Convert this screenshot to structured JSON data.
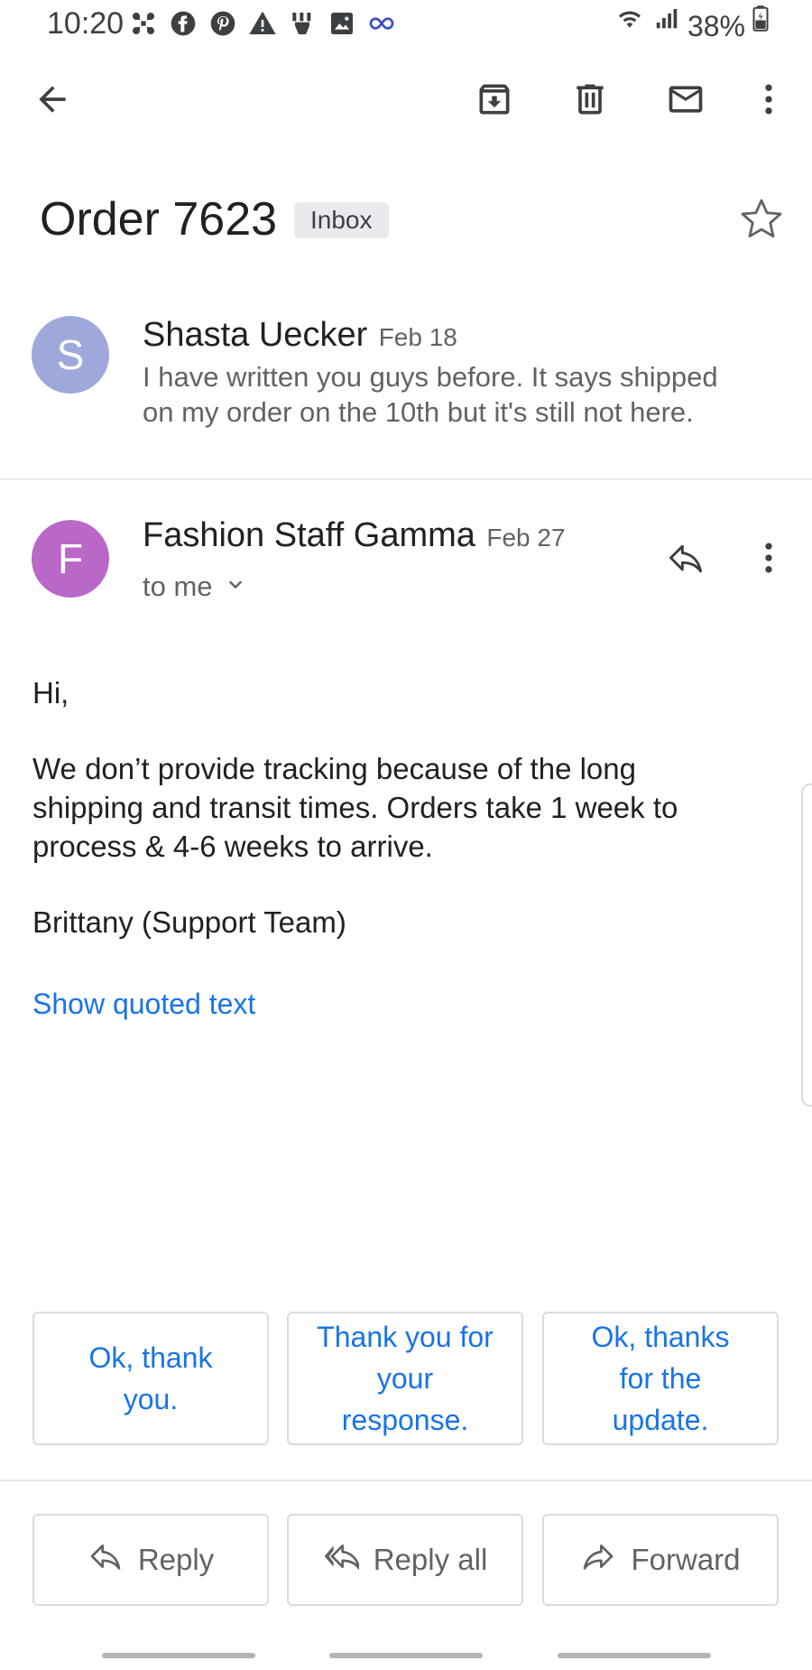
{
  "status_bar": {
    "time": "10:20",
    "battery_percent": "38%",
    "notification_icons": [
      "grid-icon",
      "facebook-icon",
      "pinterest-icon",
      "warning-icon",
      "hands-icon",
      "image-icon",
      "infinity-icon"
    ]
  },
  "toolbar": {
    "back_icon": "arrow-left-icon",
    "archive_icon": "archive-icon",
    "delete_icon": "trash-icon",
    "mark_unread_icon": "mail-icon",
    "more_icon": "more-vert-icon"
  },
  "thread": {
    "subject": "Order 7623",
    "label": "Inbox",
    "starred": false
  },
  "messages": [
    {
      "avatar_letter": "S",
      "avatar_color": "#9FA8DA",
      "sender": "Shasta Uecker",
      "date": "Feb 18",
      "snippet_line1": "I have written you guys before. It says shipped",
      "snippet_line2": "on my order on the 10th but it's still not here."
    },
    {
      "avatar_letter": "F",
      "avatar_color": "#BA68C8",
      "sender": "Fashion Staff Gamma",
      "date": "Feb 27",
      "recipient": "to me",
      "body": {
        "greeting": "Hi,",
        "line1": "We don’t provide tracking because of the long",
        "line2": "shipping and transit times. Orders take 1 week to",
        "line3": "process & 4-6 weeks to arrive.",
        "signature": "Brittany (Support Team)"
      },
      "show_quoted": "Show quoted text"
    }
  ],
  "smart_replies": [
    {
      "line1": "Ok, thank",
      "line2": "you.",
      "line3": ""
    },
    {
      "line1": "Thank you for",
      "line2": "your",
      "line3": "response."
    },
    {
      "line1": "Ok, thanks",
      "line2": "for the",
      "line3": "update."
    }
  ],
  "actions": {
    "reply": "Reply",
    "reply_all": "Reply all",
    "forward": "Forward"
  },
  "colors": {
    "accent": "#1a73e8",
    "text_primary": "#202124",
    "text_secondary": "#5f6368",
    "border": "#dadce0"
  }
}
